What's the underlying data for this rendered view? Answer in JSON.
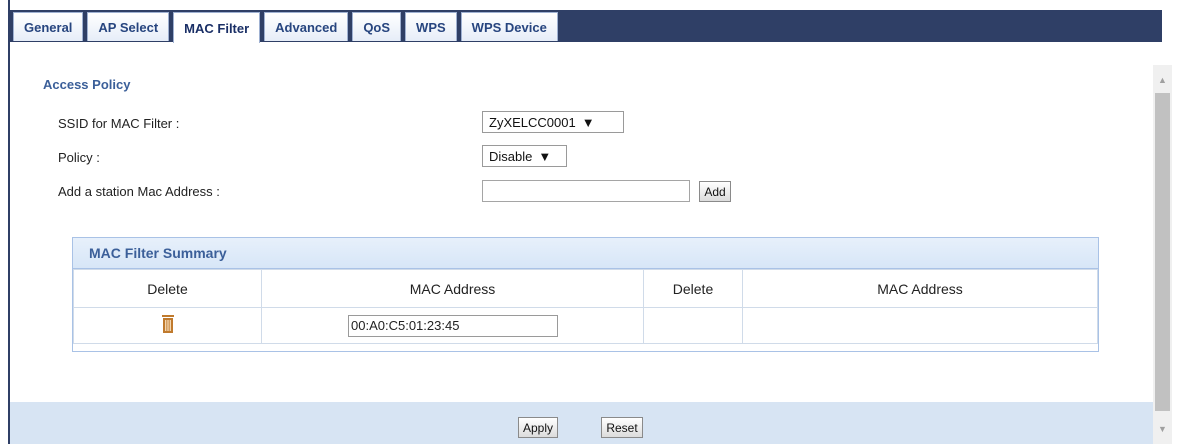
{
  "tabs": [
    {
      "label": "General",
      "active": false
    },
    {
      "label": "AP Select",
      "active": false
    },
    {
      "label": "MAC Filter",
      "active": true
    },
    {
      "label": "Advanced",
      "active": false
    },
    {
      "label": "QoS",
      "active": false
    },
    {
      "label": "WPS",
      "active": false
    },
    {
      "label": "WPS Device",
      "active": false
    }
  ],
  "access_policy": {
    "title": "Access Policy",
    "ssid_label": "SSID for MAC Filter :",
    "ssid_value": "ZyXELCC0001",
    "policy_label": "Policy :",
    "policy_value": "Disable",
    "add_label": "Add a station Mac Address :",
    "add_value": "",
    "add_button": "Add"
  },
  "summary": {
    "title": "MAC Filter Summary",
    "columns": [
      "Delete",
      "MAC Address",
      "Delete",
      "MAC Address"
    ],
    "rows": [
      {
        "mac": "00:A0:C5:01:23:45"
      }
    ]
  },
  "footer": {
    "apply": "Apply",
    "reset": "Reset"
  },
  "colors": {
    "accent": "#3b5f99",
    "tabbar": "#2f3f66",
    "trash": "#c07a2d"
  }
}
